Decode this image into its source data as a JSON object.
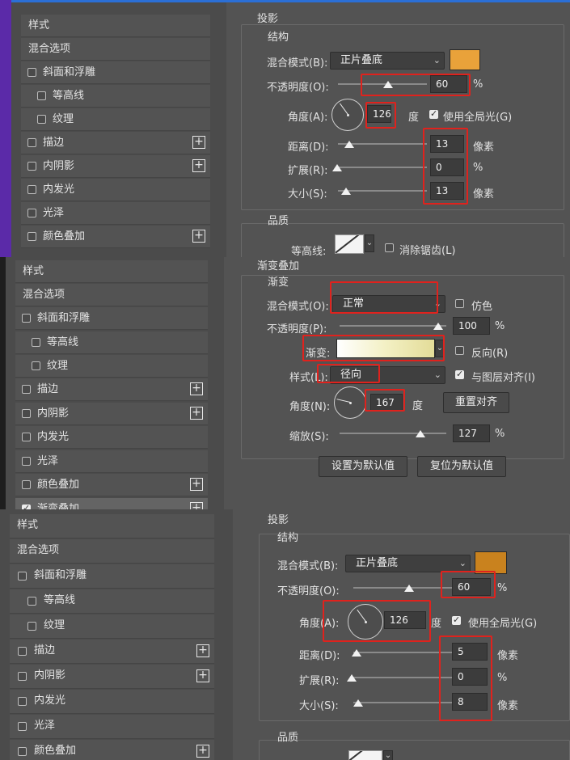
{
  "style_list": {
    "header": "样式",
    "blend_options": "混合选项",
    "items": [
      "斜面和浮雕",
      "等高线",
      "纹理",
      "描边",
      "内阴影",
      "内发光",
      "光泽",
      "颜色叠加",
      "渐变叠加"
    ]
  },
  "panel1": {
    "title": "投影",
    "section_structure": "结构",
    "blend_mode_label": "混合模式(B):",
    "blend_mode_value": "正片叠底",
    "shadow_color": "#e9a23a",
    "opacity_label": "不透明度(O):",
    "opacity_value": "60",
    "percent": "%",
    "angle_label": "角度(A):",
    "angle_value": "126",
    "degree": "度",
    "global_light_label": "使用全局光(G)",
    "distance_label": "距离(D):",
    "distance_value": "13",
    "spread_label": "扩展(R):",
    "spread_value": "0",
    "size_label": "大小(S):",
    "size_value": "13",
    "px_unit": "像素",
    "section_quality": "品质",
    "contour_label": "等高线:",
    "anti_alias_label": "消除锯齿(L)"
  },
  "panel2": {
    "title": "渐变叠加",
    "section": "渐变",
    "blend_mode_label": "混合模式(O):",
    "blend_mode_value": "正常",
    "dither_label": "仿色",
    "opacity_label": "不透明度(P):",
    "opacity_value": "100",
    "percent": "%",
    "gradient_label": "渐变:",
    "gradient_colors": [
      "#ffffff",
      "#f3f0c4",
      "#e3dc98"
    ],
    "reverse_label": "反向(R)",
    "style_label": "样式(L):",
    "style_value": "径向",
    "align_label": "与图层对齐(I)",
    "angle_label": "角度(N):",
    "angle_value": "167",
    "degree": "度",
    "reset_align_label": "重置对齐",
    "scale_label": "缩放(S):",
    "scale_value": "127",
    "set_default_label": "设置为默认值",
    "reset_default_label": "复位为默认值"
  },
  "panel3": {
    "title": "投影",
    "section_structure": "结构",
    "blend_mode_label": "混合模式(B):",
    "blend_mode_value": "正片叠底",
    "shadow_color": "#c9821e",
    "opacity_label": "不透明度(O):",
    "opacity_value": "60",
    "percent": "%",
    "angle_label": "角度(A):",
    "angle_value": "126",
    "degree": "度",
    "global_light_label": "使用全局光(G)",
    "distance_label": "距离(D):",
    "distance_value": "5",
    "spread_label": "扩展(R):",
    "spread_value": "0",
    "size_label": "大小(S):",
    "size_value": "8",
    "px_unit": "像素",
    "section_quality": "品质"
  },
  "colors": {
    "highlight_red": "#e0221d",
    "accent_purple": "#5b2aa8",
    "accent_blue": "#2b6fd6"
  }
}
